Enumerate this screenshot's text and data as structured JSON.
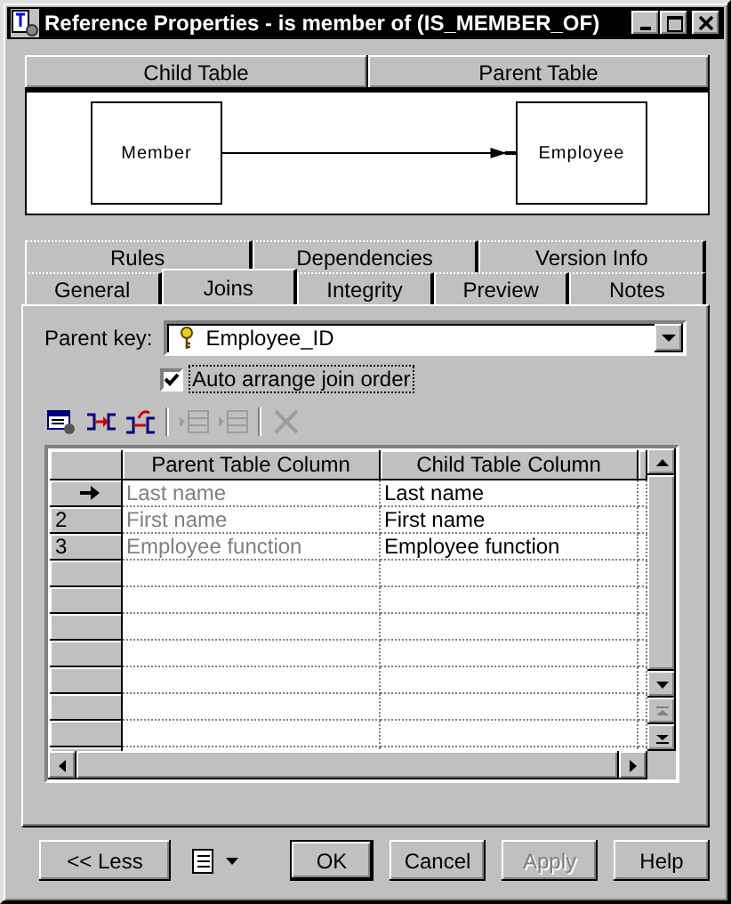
{
  "window": {
    "title": "Reference Properties - is member of (IS_MEMBER_OF)"
  },
  "diagram": {
    "headers": [
      "Child Table",
      "Parent Table"
    ],
    "child": "Member",
    "parent": "Employee"
  },
  "tab_rows": [
    {
      "tabs": [
        {
          "label": "Rules",
          "selected": false
        },
        {
          "label": "Dependencies",
          "selected": false
        },
        {
          "label": "Version Info",
          "selected": false
        }
      ]
    },
    {
      "tabs": [
        {
          "label": "General",
          "selected": false
        },
        {
          "label": "Joins",
          "selected": true
        },
        {
          "label": "Integrity",
          "selected": false
        },
        {
          "label": "Preview",
          "selected": false
        },
        {
          "label": "Notes",
          "selected": false
        }
      ]
    }
  ],
  "parent_key": {
    "label": "Parent key:",
    "value": "Employee_ID"
  },
  "auto_arrange": {
    "label": "Auto arrange join order",
    "checked": true
  },
  "toolbar": [
    {
      "kind": "properties",
      "disabled": false
    },
    {
      "kind": "join",
      "disabled": false
    },
    {
      "kind": "reuse",
      "disabled": false
    },
    {
      "kind": "insert",
      "disabled": true
    },
    {
      "kind": "add",
      "disabled": true
    },
    {
      "kind": "delete",
      "disabled": true
    }
  ],
  "grid": {
    "columns": [
      {
        "label": "Parent Table Column",
        "disabled": true
      },
      {
        "label": "Child Table Column",
        "disabled": false
      }
    ],
    "rows": [
      {
        "header": "",
        "current": true,
        "cells": [
          "Last name",
          "Last name"
        ]
      },
      {
        "header": "2",
        "current": false,
        "cells": [
          "First name",
          "First name"
        ]
      },
      {
        "header": "3",
        "current": false,
        "cells": [
          "Employee function",
          "Employee function"
        ]
      }
    ]
  },
  "less_button": "<< Less",
  "buttons": [
    {
      "label": "OK",
      "default": true,
      "disabled": false
    },
    {
      "label": "Cancel",
      "default": false,
      "disabled": false
    },
    {
      "label": "Apply",
      "default": false,
      "disabled": true
    },
    {
      "label": "Help",
      "default": false,
      "disabled": false
    }
  ]
}
